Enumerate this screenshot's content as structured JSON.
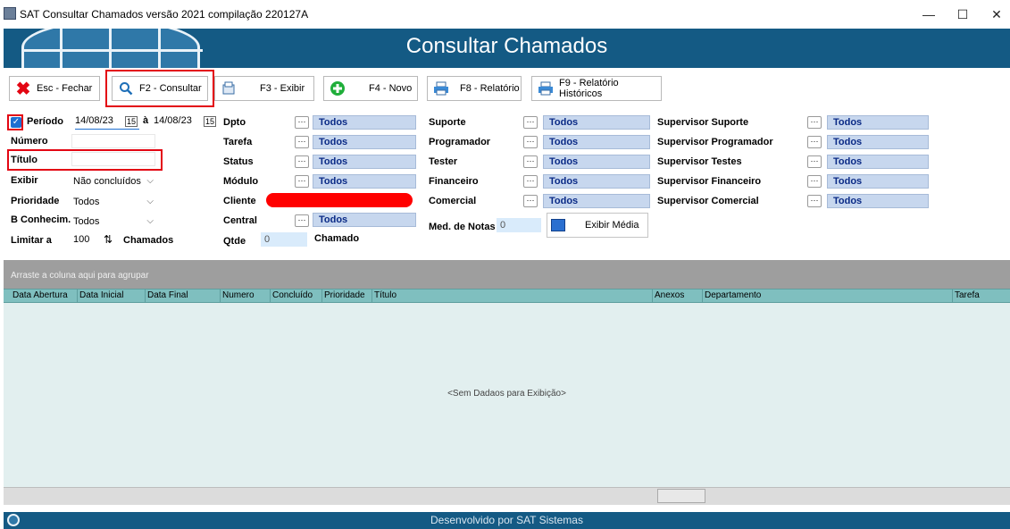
{
  "window": {
    "title": "SAT Consultar Chamados versão 2021 compilação 220127A",
    "minimize": "—",
    "maximize": "☐",
    "close": "✕"
  },
  "header": {
    "title": "Consultar Chamados"
  },
  "toolbar": {
    "close_label": "Esc - Fechar",
    "consult_label": "F2 - Consultar",
    "show_label": "F3 - Exibir",
    "new_label": "F4 - Novo",
    "report_label": "F8 - Relatório",
    "history_label": "F9 - Relatório Históricos"
  },
  "filters": {
    "periodo_label": "Período",
    "periodo_checked": true,
    "date_from": "14/08/23",
    "date_sep": "à",
    "date_to": "14/08/23",
    "numero_label": "Número",
    "titulo_label": "Título",
    "exibir_label": "Exibir",
    "exibir_value": "Não concluídos",
    "prioridade_label": "Prioridade",
    "prioridade_value": "Todos",
    "bconhecim_label": "B Conhecim.",
    "bconhecim_value": "Todos",
    "limitar_label": "Limitar a",
    "limitar_value": "100",
    "chamados_label": "Chamados",
    "col2": [
      {
        "label": "Dpto",
        "value": "Todos"
      },
      {
        "label": "Tarefa",
        "value": "Todos"
      },
      {
        "label": "Status",
        "value": "Todos"
      },
      {
        "label": "Módulo",
        "value": "Todos"
      },
      {
        "label": "Cliente",
        "value": ""
      },
      {
        "label": "Central",
        "value": "Todos"
      }
    ],
    "qtde_label": "Qtde",
    "qtde_value": "0",
    "chamado_label": "Chamado",
    "col3": [
      {
        "label": "Suporte",
        "value": "Todos"
      },
      {
        "label": "Programador",
        "value": "Todos"
      },
      {
        "label": "Tester",
        "value": "Todos"
      },
      {
        "label": "Financeiro",
        "value": "Todos"
      },
      {
        "label": "Comercial",
        "value": "Todos"
      }
    ],
    "med_notas_label": "Med. de Notas",
    "med_notas_value": "0",
    "exibir_media_label": "Exibir Média",
    "col4": [
      {
        "label": "Supervisor Suporte",
        "value": "Todos"
      },
      {
        "label": "Supervisor Programador",
        "value": "Todos"
      },
      {
        "label": "Supervisor Testes",
        "value": "Todos"
      },
      {
        "label": "Supervisor Financeiro",
        "value": "Todos"
      },
      {
        "label": "Supervisor Comercial",
        "value": "Todos"
      }
    ]
  },
  "grid": {
    "group_hint": "Arraste a coluna aqui para agrupar",
    "columns": [
      "Data Abertura",
      "Data Inicial",
      "Data Final",
      "Numero",
      "Concluído",
      "Prioridade",
      "Título",
      "Anexos",
      "Departamento",
      "Tarefa"
    ],
    "empty_text": "<Sem Dadaos para Exibição>"
  },
  "status": {
    "text": "Desenvolvido por SAT Sistemas"
  },
  "colors": {
    "banner": "#145a84",
    "highlight": "#e30613",
    "todos_field": "#c7d7ee"
  }
}
